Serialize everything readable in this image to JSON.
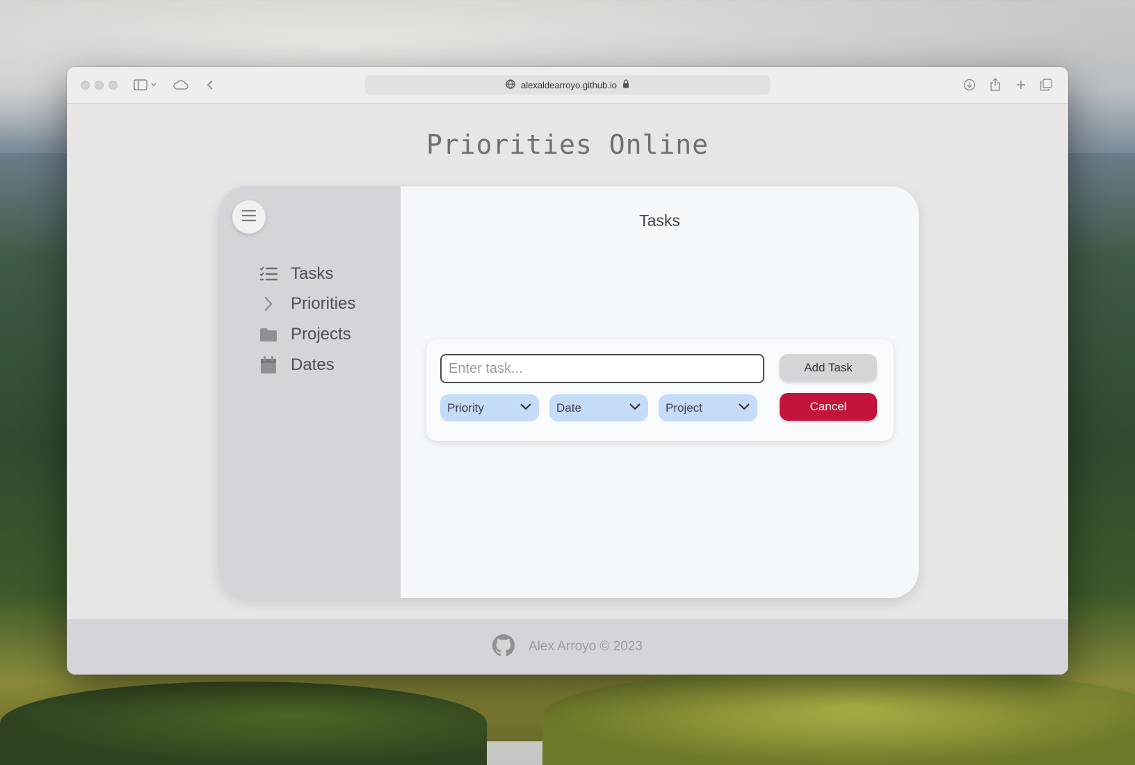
{
  "browser": {
    "url": "alexaldearroyo.github.io"
  },
  "page": {
    "title": "Priorities Online"
  },
  "sidebar": {
    "items": [
      {
        "label": "Tasks",
        "icon": "checklist-icon"
      },
      {
        "label": "Priorities",
        "icon": "chevron-right-icon"
      },
      {
        "label": "Projects",
        "icon": "folder-icon"
      },
      {
        "label": "Dates",
        "icon": "calendar-icon"
      }
    ]
  },
  "main": {
    "title": "Tasks",
    "form": {
      "task_placeholder": "Enter task...",
      "task_value": "",
      "add_label": "Add Task",
      "cancel_label": "Cancel",
      "priority_label": "Priority",
      "date_label": "Date",
      "project_label": "Project"
    }
  },
  "footer": {
    "text": "Alex Arroyo © 2023"
  },
  "colors": {
    "sidebar_bg": "#d5d4d9",
    "main_bg": "#f4f8fb",
    "select_bg": "#c4dcf7",
    "cancel_bg": "#c3143c"
  }
}
